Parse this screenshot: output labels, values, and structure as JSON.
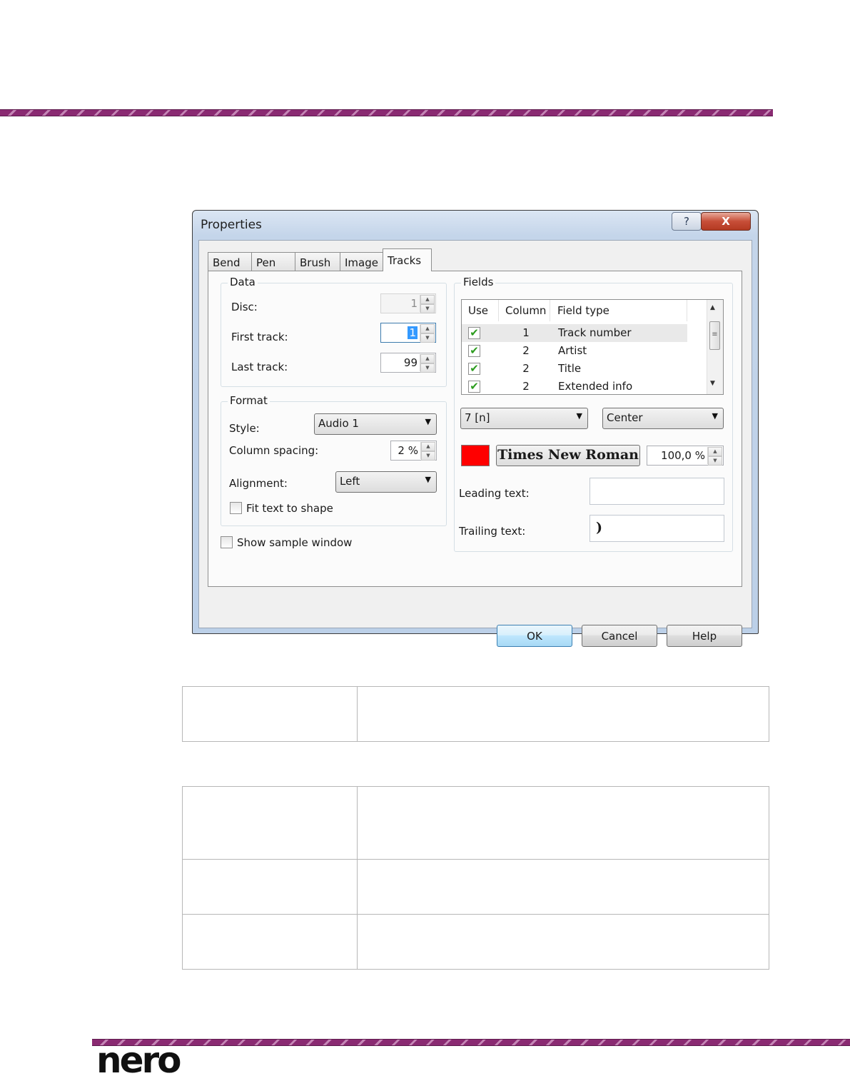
{
  "dialog": {
    "title": "Properties",
    "help_caption": "?",
    "close_caption": "X",
    "tabs": [
      {
        "label": "Bend"
      },
      {
        "label": "Pen"
      },
      {
        "label": "Brush"
      },
      {
        "label": "Image"
      },
      {
        "label": "Tracks",
        "active": true
      }
    ],
    "data_group": {
      "label": "Data",
      "disc_label": "Disc:",
      "disc_value": "1",
      "first_track_label": "First track:",
      "first_track_value": "1",
      "last_track_label": "Last track:",
      "last_track_value": "99"
    },
    "format_group": {
      "label": "Format",
      "style_label": "Style:",
      "style_value": "Audio 1",
      "column_spacing_label": "Column spacing:",
      "column_spacing_value": "2 %",
      "alignment_label": "Alignment:",
      "alignment_value": "Left",
      "fit_text_label": "Fit text to shape",
      "fit_text_checked": false
    },
    "show_sample_label": "Show sample window",
    "show_sample_checked": false,
    "fields_group": {
      "label": "Fields",
      "columns": [
        "Use",
        "Column",
        "Field type"
      ],
      "rows": [
        {
          "use": true,
          "column": "1",
          "field_type": "Track number",
          "selected": true
        },
        {
          "use": true,
          "column": "2",
          "field_type": "Artist"
        },
        {
          "use": true,
          "column": "2",
          "field_type": "Title"
        },
        {
          "use": true,
          "column": "2",
          "field_type": "Extended info"
        }
      ],
      "format_value": "7 [n]",
      "align_value": "Center",
      "font_color": "#ff0000",
      "font_name": "Times New Roman",
      "font_scale_value": "100,0 %",
      "leading_text_label": "Leading text:",
      "leading_text_value": "",
      "trailing_text_label": "Trailing text:",
      "trailing_text_value": ")"
    },
    "buttons": {
      "ok": "OK",
      "cancel": "Cancel",
      "help": "Help"
    }
  },
  "footer": {
    "logo_text": "nero"
  }
}
